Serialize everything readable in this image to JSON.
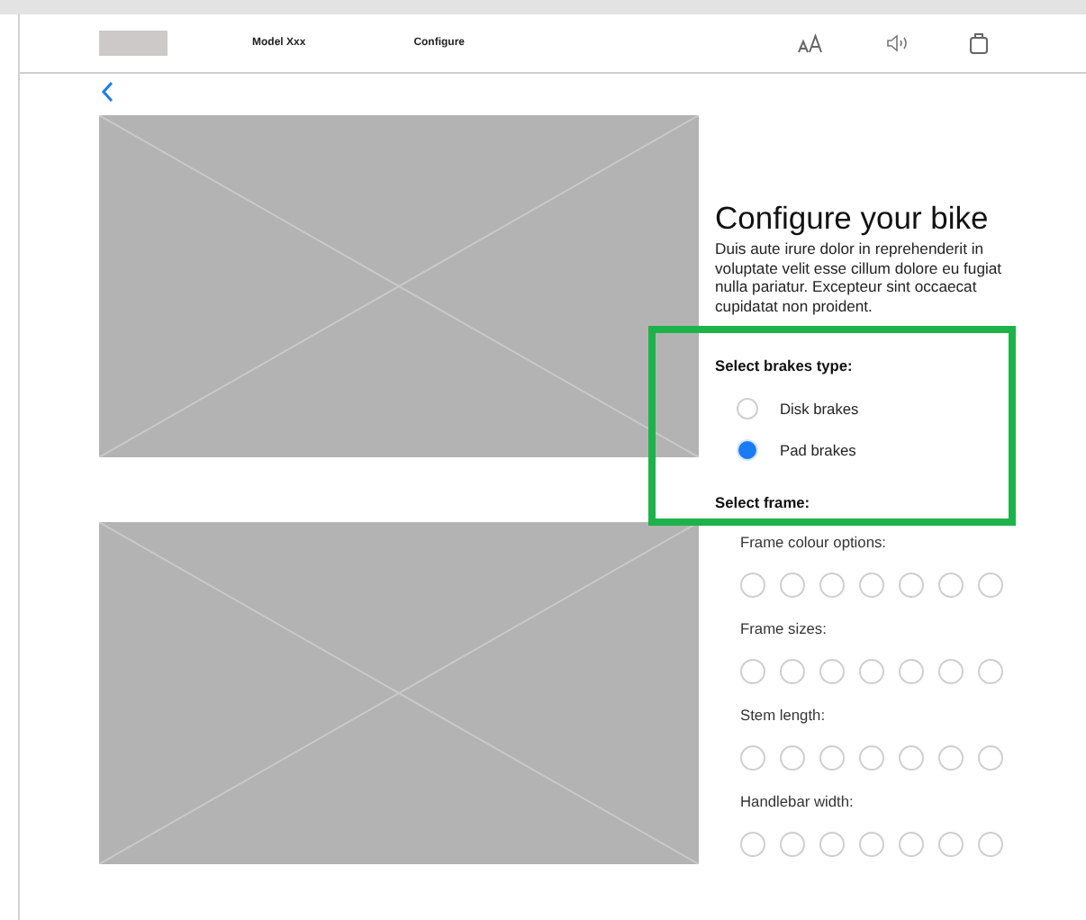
{
  "header": {
    "nav": [
      "Model Xxx",
      "Configure"
    ]
  },
  "title": "Configure your bike",
  "description": "Duis aute irure dolor in reprehenderit in voluptate velit esse cillum dolore eu fugiat nulla pariatur. Excepteur sint occaecat cupidatat non proident.",
  "brakes": {
    "label": "Select brakes type:",
    "options": [
      {
        "label": "Disk brakes",
        "selected": false
      },
      {
        "label": "Pad brakes",
        "selected": true
      }
    ]
  },
  "frame": {
    "label": "Select frame:",
    "groups": [
      {
        "label": "Frame colour options:",
        "options": [
          {
            "selected": false
          },
          {
            "selected": false
          },
          {
            "selected": false
          },
          {
            "selected": false
          },
          {
            "selected": false
          },
          {
            "selected": false
          },
          {
            "selected": false
          }
        ]
      },
      {
        "label": "Frame sizes:",
        "options": [
          {
            "selected": false
          },
          {
            "selected": false
          },
          {
            "selected": false
          },
          {
            "selected": false
          },
          {
            "selected": false
          },
          {
            "selected": false
          },
          {
            "selected": false
          }
        ]
      },
      {
        "label": "Stem length:",
        "options": [
          {
            "selected": false
          },
          {
            "selected": false
          },
          {
            "selected": false
          },
          {
            "selected": false
          },
          {
            "selected": false
          },
          {
            "selected": false
          },
          {
            "selected": false
          }
        ]
      },
      {
        "label": "Handlebar width:",
        "options": [
          {
            "selected": false
          },
          {
            "selected": false
          },
          {
            "selected": false
          },
          {
            "selected": false
          },
          {
            "selected": false
          },
          {
            "selected": false
          },
          {
            "selected": false
          }
        ]
      }
    ]
  },
  "annotations": [
    {
      "kind": "highlight"
    }
  ]
}
